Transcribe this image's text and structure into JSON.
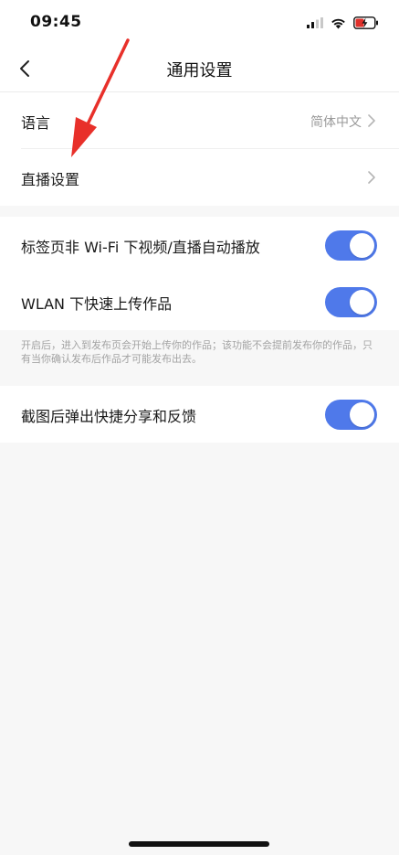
{
  "status_bar": {
    "time": "09:45"
  },
  "nav": {
    "title": "通用设置"
  },
  "settings": {
    "language_label": "语言",
    "language_value": "简体中文",
    "live_label": "直播设置",
    "autoplay_label": "标签页非 Wi-Fi 下视频/直播自动播放",
    "autoplay_on": true,
    "wlan_upload_label": "WLAN 下快速上传作品",
    "wlan_upload_on": true,
    "wlan_upload_note": "开启后，进入到发布页会开始上传你的作品；该功能不会提前发布你的作品，只有当你确认发布后作品才可能发布出去。",
    "screenshot_share_label": "截图后弹出快捷分享和反馈",
    "screenshot_share_on": true
  },
  "colors": {
    "toggle_on": "#4f79ea",
    "annotation": "#e8302a",
    "background": "#f7f7f7"
  },
  "icons": {
    "back": "chevron-left-icon",
    "row_arrow": "chevron-right-icon",
    "signal": "signal-icon",
    "wifi": "wifi-icon",
    "battery": "battery-charging-icon"
  }
}
